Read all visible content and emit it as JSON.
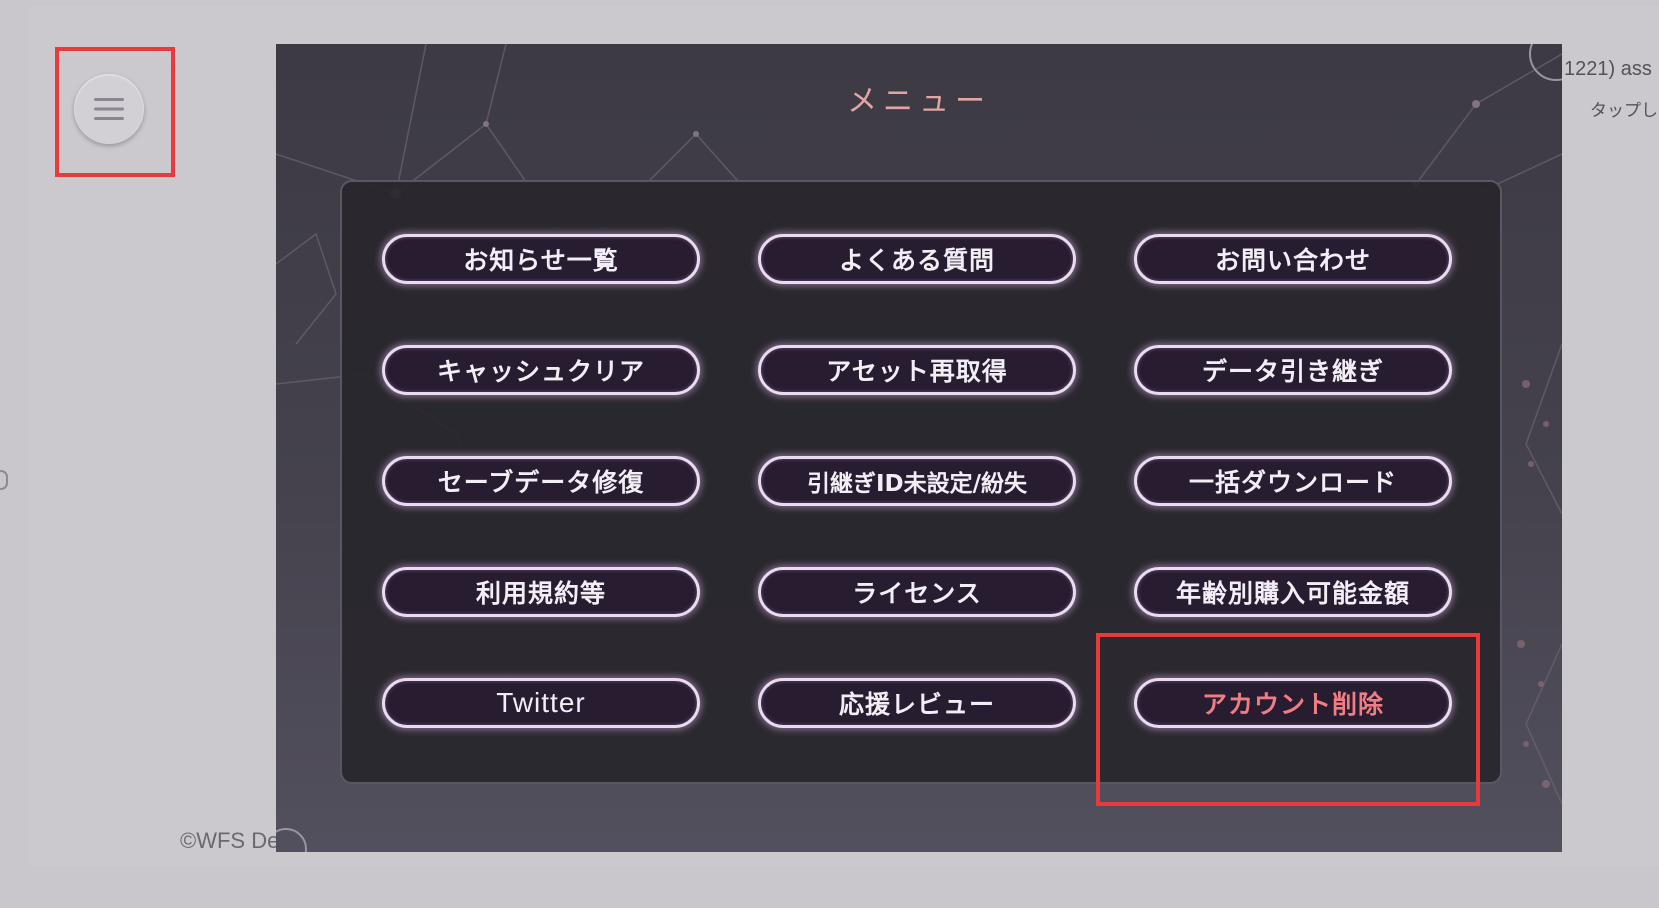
{
  "app": {
    "copyright": "©WFS De",
    "side_text_top": "1221) ass",
    "side_text_bottom": "タップし"
  },
  "menu_toggle": {
    "icon": "hamburger-icon"
  },
  "menu": {
    "title": "メニュー",
    "buttons": [
      {
        "label": "お知らせ一覧"
      },
      {
        "label": "よくある質問"
      },
      {
        "label": "お問い合わせ"
      },
      {
        "label": "キャッシュクリア"
      },
      {
        "label": "アセット再取得"
      },
      {
        "label": "データ引き継ぎ"
      },
      {
        "label": "セーブデータ修復"
      },
      {
        "label": "引継ぎID未設定/紛失"
      },
      {
        "label": "一括ダウンロード"
      },
      {
        "label": "利用規約等"
      },
      {
        "label": "ライセンス"
      },
      {
        "label": "年齢別購入可能金額"
      },
      {
        "label": "Twitter"
      },
      {
        "label": "応援レビュー"
      },
      {
        "label": "アカウント削除"
      }
    ]
  },
  "colors": {
    "highlight": "#e8393c",
    "danger_text": "#f07d83",
    "title_text": "#e2a5a3",
    "button_bg": "#271c30"
  }
}
